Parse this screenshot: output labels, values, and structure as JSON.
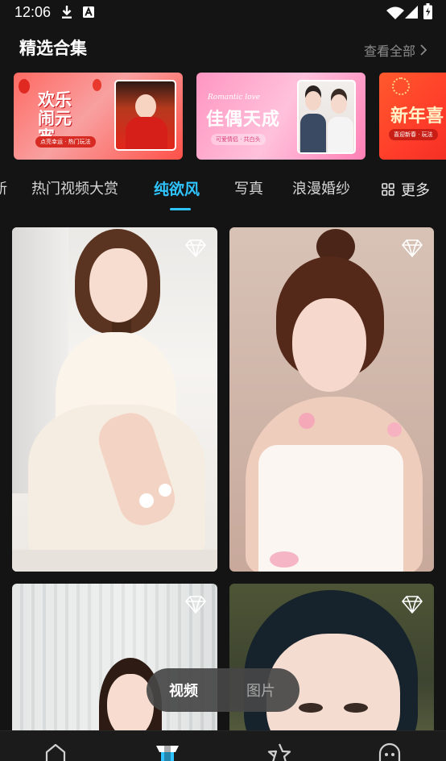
{
  "status_bar": {
    "time": "12:06",
    "icons": [
      "download-icon",
      "font-a-icon",
      "wifi-icon",
      "signal-icon",
      "battery-icon"
    ]
  },
  "section": {
    "title": "精选合集",
    "view_all": "查看全部"
  },
  "banners": [
    {
      "title": "欢乐闹元宵",
      "caption": "点亮幸运 · 热门玩法"
    },
    {
      "title": "佳偶天成",
      "subtitle": "Romantic love",
      "caption": "可爱情侣 · 共白头"
    },
    {
      "title": "新年喜",
      "caption": "喜迎新春 · 玩法"
    }
  ],
  "tabs": {
    "items": [
      "新",
      "热门视频大赏",
      "纯欲风",
      "写真",
      "浪漫婚纱"
    ],
    "active_index": 2,
    "more_label": "更多"
  },
  "media_switch": {
    "video_label": "视频",
    "image_label": "图片",
    "selected": "视频"
  },
  "bottom_nav": {
    "items": [
      "home-icon",
      "templates-icon",
      "star-icon",
      "profile-icon"
    ],
    "active_index": 1
  },
  "colors": {
    "background": "#141414",
    "accent": "#2fc4ff",
    "muted_text": "#8b8b8b"
  }
}
